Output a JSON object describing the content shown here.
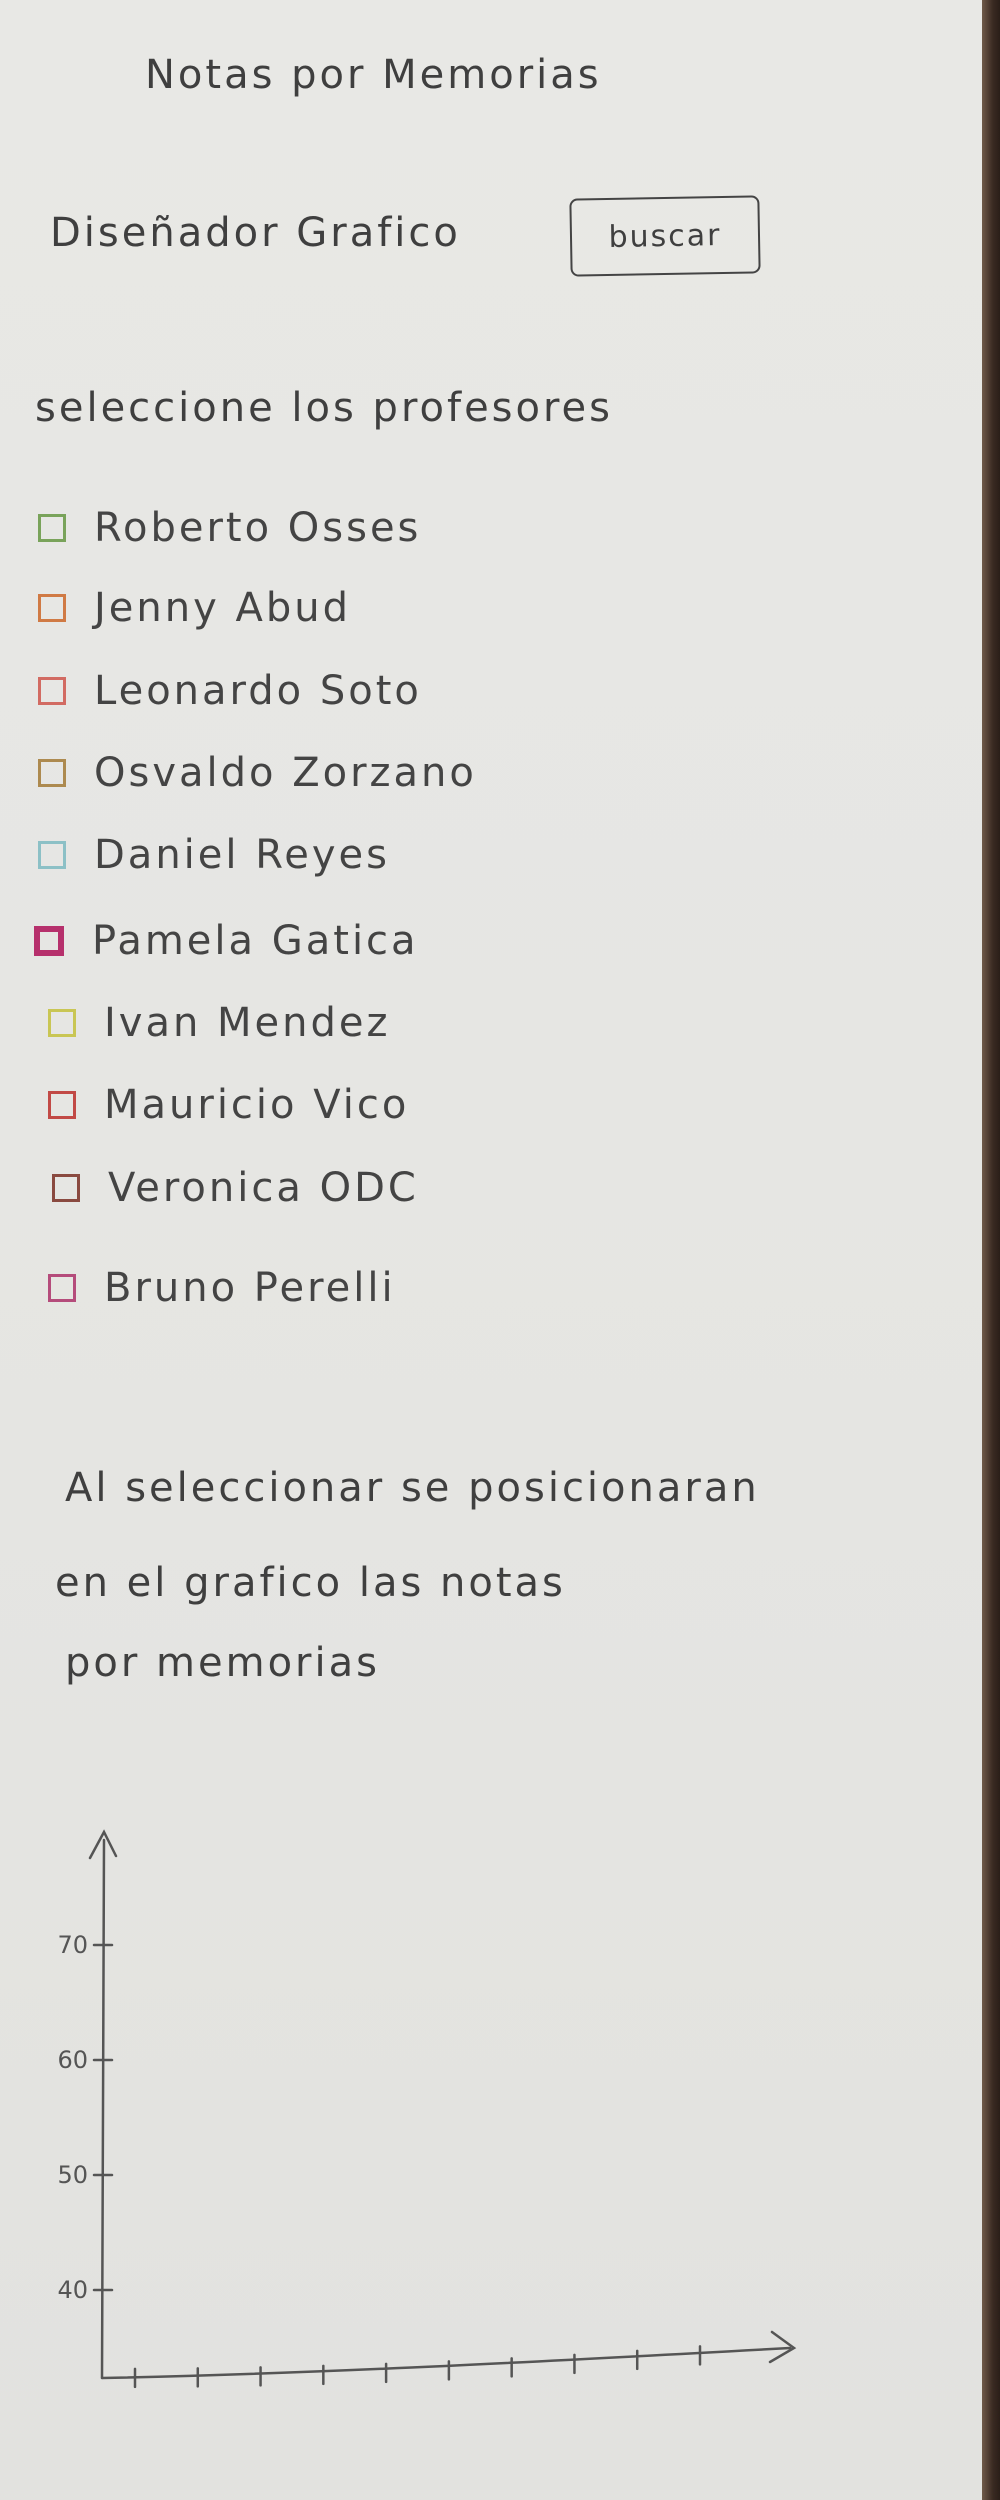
{
  "header": {
    "title": "Notas por Memorias",
    "role_label": "Diseñador Grafico",
    "search_button": "buscar"
  },
  "selector": {
    "prompt": "seleccione los profesores",
    "professors": [
      {
        "name": "Roberto Osses",
        "color": "#79a35a"
      },
      {
        "name": "Jenny Abud",
        "color": "#d07a44"
      },
      {
        "name": "Leonardo Soto",
        "color": "#d26b62"
      },
      {
        "name": "Osvaldo Zorzano",
        "color": "#ad8a4f"
      },
      {
        "name": "Daniel Reyes",
        "color": "#8cc0c6"
      },
      {
        "name": "Pamela Gatica",
        "color": "#b6306c"
      },
      {
        "name": "Ivan Mendez",
        "color": "#c9c654"
      },
      {
        "name": "Mauricio Vico",
        "color": "#c24a46"
      },
      {
        "name": "Veronica ODC",
        "color": "#8a4a40"
      },
      {
        "name": "Bruno Perelli",
        "color": "#b54c7b"
      }
    ]
  },
  "note": {
    "line1": "Al seleccionar se posicionaran",
    "line2": "en el grafico las notas",
    "line3": "por memorias"
  },
  "chart_data": {
    "type": "scatter",
    "title": "",
    "xlabel": "",
    "ylabel": "",
    "y_ticks": [
      40,
      50,
      60,
      70
    ],
    "ylim": [
      35,
      75
    ],
    "x_tick_count": 10,
    "series": [],
    "grid": false
  }
}
